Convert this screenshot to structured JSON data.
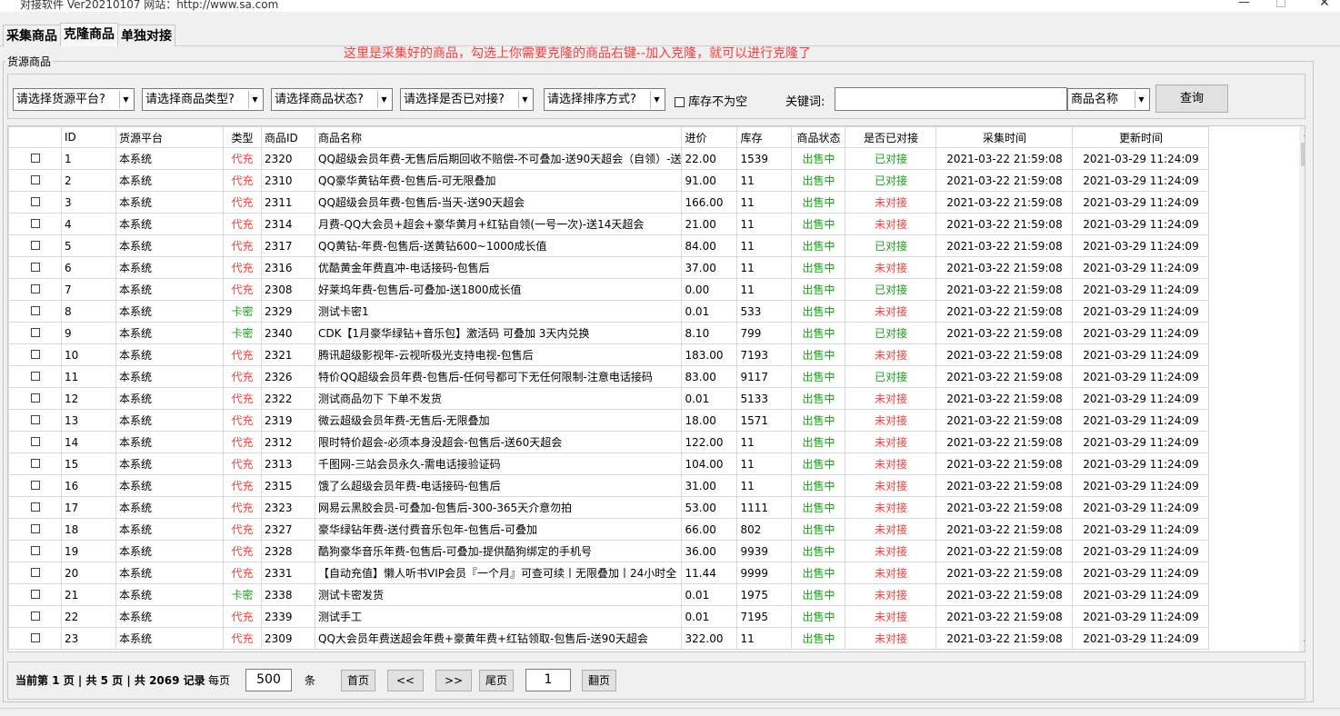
{
  "window": {
    "title": "对接软件 Ver20210107 网站：http://www.sa.com"
  },
  "tabs": [
    {
      "label": "采集商品"
    },
    {
      "label": "克隆商品"
    },
    {
      "label": "单独对接"
    }
  ],
  "notice": "这里是采集好的商品，勾选上你需要克隆的商品右键--加入克隆，就可以进行克隆了",
  "group": {
    "label": "货源商品"
  },
  "filters": {
    "platform": "请选择货源平台?",
    "type": "请选择商品类型?",
    "status": "请选择商品状态?",
    "docked": "请选择是否已对接?",
    "sort": "请选择排序方式?",
    "stock_not_empty": "库存不为空",
    "keyword_label": "关键词:",
    "keyword_value": "",
    "field": "商品名称",
    "query": "查询"
  },
  "colors": {
    "red": "#ff3b3b",
    "green": "#18a018"
  },
  "table": {
    "columns": [
      "",
      "ID",
      "货源平台",
      "类型",
      "商品ID",
      "商品名称",
      "进价",
      "库存",
      "商品状态",
      "是否已对接",
      "采集时间",
      "更新时间"
    ],
    "rows": [
      [
        "1",
        "本系统",
        "代充",
        "2320",
        "QQ超级会员年费-无售后后期回收不赔偿-不可叠加-送90天超会（自领）-送",
        "22.00",
        "1539",
        "出售中",
        "已对接",
        "2021-03-22 21:59:08",
        "2021-03-29 11:24:09"
      ],
      [
        "2",
        "本系统",
        "代充",
        "2310",
        "QQ豪华黄钻年费-包售后-可无限叠加",
        "91.00",
        "11",
        "出售中",
        "已对接",
        "2021-03-22 21:59:08",
        "2021-03-29 11:24:09"
      ],
      [
        "3",
        "本系统",
        "代充",
        "2311",
        "QQ超级会员年费-包售后-当天-送90天超会",
        "166.00",
        "11",
        "出售中",
        "未对接",
        "2021-03-22 21:59:08",
        "2021-03-29 11:24:09"
      ],
      [
        "4",
        "本系统",
        "代充",
        "2314",
        "月费-QQ大会员+超会+豪华黄月+红钻自领(一号一次)-送14天超会",
        "21.00",
        "11",
        "出售中",
        "未对接",
        "2021-03-22 21:59:08",
        "2021-03-29 11:24:09"
      ],
      [
        "5",
        "本系统",
        "代充",
        "2317",
        "QQ黄钻-年费-包售后-送黄钻600~1000成长值",
        "84.00",
        "11",
        "出售中",
        "已对接",
        "2021-03-22 21:59:08",
        "2021-03-29 11:24:09"
      ],
      [
        "6",
        "本系统",
        "代充",
        "2316",
        "优酷黄金年费直冲-电话接码-包售后",
        "37.00",
        "11",
        "出售中",
        "未对接",
        "2021-03-22 21:59:08",
        "2021-03-29 11:24:09"
      ],
      [
        "7",
        "本系统",
        "代充",
        "2308",
        "好莱坞年费-包售后-可叠加-送1800成长值",
        "0.00",
        "11",
        "出售中",
        "已对接",
        "2021-03-22 21:59:08",
        "2021-03-29 11:24:09"
      ],
      [
        "8",
        "本系统",
        "卡密",
        "2329",
        "测试卡密1",
        "0.01",
        "533",
        "出售中",
        "未对接",
        "2021-03-22 21:59:08",
        "2021-03-29 11:24:09"
      ],
      [
        "9",
        "本系统",
        "卡密",
        "2340",
        "CDK【1月豪华绿钻+音乐包】激活码 可叠加 3天内兑换",
        "8.10",
        "799",
        "出售中",
        "已对接",
        "2021-03-22 21:59:08",
        "2021-03-29 11:24:09"
      ],
      [
        "10",
        "本系统",
        "代充",
        "2321",
        "腾讯超级影视年-云视听极光支持电视-包售后",
        "183.00",
        "7193",
        "出售中",
        "未对接",
        "2021-03-22 21:59:08",
        "2021-03-29 11:24:09"
      ],
      [
        "11",
        "本系统",
        "代充",
        "2326",
        "特价QQ超级会员年费-包售后-任何号都可下无任何限制-注意电话接码",
        "83.00",
        "9117",
        "出售中",
        "已对接",
        "2021-03-22 21:59:08",
        "2021-03-29 11:24:09"
      ],
      [
        "12",
        "本系统",
        "代充",
        "2322",
        "测试商品勿下 下单不发货",
        "0.01",
        "5133",
        "出售中",
        "未对接",
        "2021-03-22 21:59:08",
        "2021-03-29 11:24:09"
      ],
      [
        "13",
        "本系统",
        "代充",
        "2319",
        "微云超级会员年费-无售后-无限叠加",
        "18.00",
        "1571",
        "出售中",
        "未对接",
        "2021-03-22 21:59:08",
        "2021-03-29 11:24:09"
      ],
      [
        "14",
        "本系统",
        "代充",
        "2312",
        "限时特价超会-必须本身没超会-包售后-送60天超会",
        "122.00",
        "11",
        "出售中",
        "未对接",
        "2021-03-22 21:59:08",
        "2021-03-29 11:24:09"
      ],
      [
        "15",
        "本系统",
        "代充",
        "2313",
        "千图网-三站会员永久-需电话接验证码",
        "104.00",
        "11",
        "出售中",
        "未对接",
        "2021-03-22 21:59:08",
        "2021-03-29 11:24:09"
      ],
      [
        "16",
        "本系统",
        "代充",
        "2315",
        "饿了么超级会员年费-电话接码-包售后",
        "31.00",
        "11",
        "出售中",
        "未对接",
        "2021-03-22 21:59:08",
        "2021-03-29 11:24:09"
      ],
      [
        "17",
        "本系统",
        "代充",
        "2323",
        "网易云黑胶会员-可叠加-包售后-300-365天介意勿拍",
        "53.00",
        "1111",
        "出售中",
        "未对接",
        "2021-03-22 21:59:08",
        "2021-03-29 11:24:09"
      ],
      [
        "18",
        "本系统",
        "代充",
        "2327",
        "豪华绿钻年费-送付费音乐包年-包售后-可叠加",
        "66.00",
        "802",
        "出售中",
        "未对接",
        "2021-03-22 21:59:08",
        "2021-03-29 11:24:09"
      ],
      [
        "19",
        "本系统",
        "代充",
        "2328",
        "酷狗豪华音乐年费-包售后-可叠加-提供酷狗绑定的手机号",
        "36.00",
        "9939",
        "出售中",
        "未对接",
        "2021-03-22 21:59:08",
        "2021-03-29 11:24:09"
      ],
      [
        "20",
        "本系统",
        "代充",
        "2331",
        "【自动充值】懒人听书VIP会员『一个月』可查可续丨无限叠加丨24小时全",
        "11.44",
        "9999",
        "出售中",
        "未对接",
        "2021-03-22 21:59:08",
        "2021-03-29 11:24:09"
      ],
      [
        "21",
        "本系统",
        "卡密",
        "2338",
        "测试卡密发货",
        "0.01",
        "1975",
        "出售中",
        "未对接",
        "2021-03-22 21:59:08",
        "2021-03-29 11:24:09"
      ],
      [
        "22",
        "本系统",
        "代充",
        "2339",
        "测试手工",
        "0.01",
        "7195",
        "出售中",
        "未对接",
        "2021-03-22 21:59:08",
        "2021-03-29 11:24:09"
      ],
      [
        "23",
        "本系统",
        "代充",
        "2309",
        "QQ大会员年费送超会年费+豪黄年费+红钻领取-包售后-送90天超会",
        "322.00",
        "11",
        "出售中",
        "未对接",
        "2021-03-22 21:59:08",
        "2021-03-29 11:24:09"
      ]
    ]
  },
  "pager": {
    "info": "当前第 1 页 | 共 5 页 | 共 2069 记录",
    "per_page_label": "每页",
    "per_page_value": "500",
    "per_page_unit": "条",
    "first": "首页",
    "prev": "<<",
    "next": ">>",
    "last": "尾页",
    "page_value": "1",
    "goto": "翻页"
  }
}
